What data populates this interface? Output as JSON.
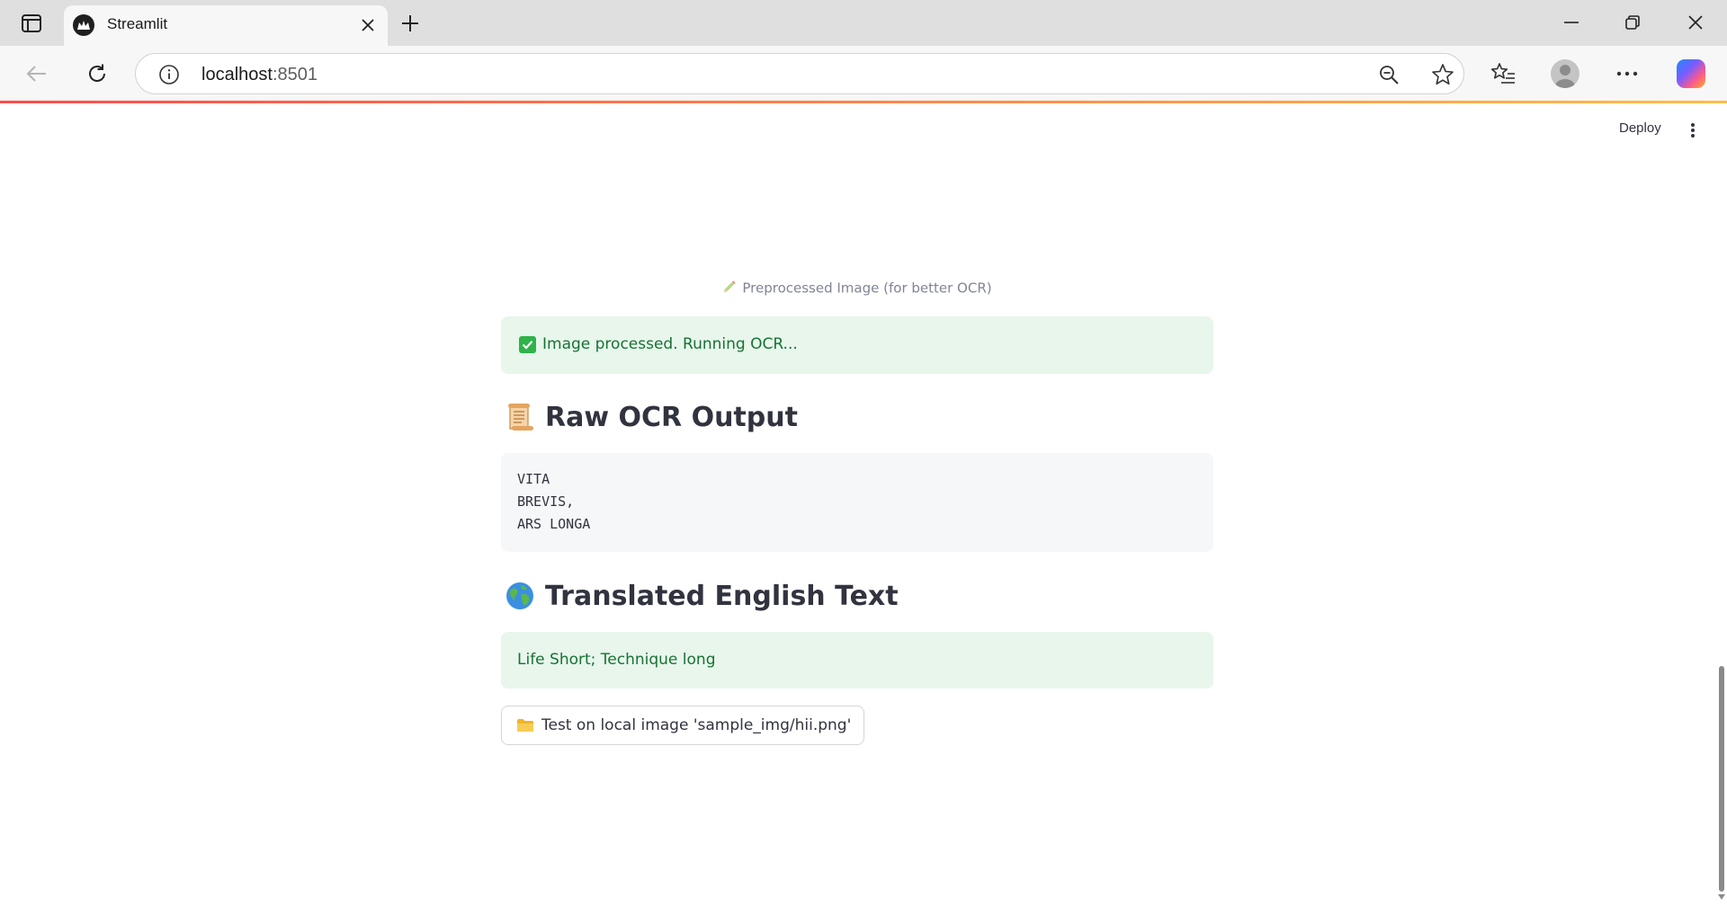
{
  "browser": {
    "tab_title": "Streamlit",
    "url_host": "localhost",
    "url_port": ":8501"
  },
  "header": {
    "deploy_label": "Deploy"
  },
  "main": {
    "image_caption": "Preprocessed Image (for better OCR)",
    "success_message": "Image processed. Running OCR...",
    "raw_ocr_heading": "Raw OCR Output",
    "raw_ocr_lines": [
      "VITA",
      "BREVIS,",
      "ARS LONGA"
    ],
    "translated_heading": "Translated English Text",
    "translated_text": "Life Short; Technique long",
    "test_button_label": "Test on local image 'sample_img/hii.png'"
  },
  "colors": {
    "accent_red": "#ff4b4b",
    "success_bg": "#e8f6ec",
    "success_text": "#177233",
    "text_primary": "#31333f"
  }
}
